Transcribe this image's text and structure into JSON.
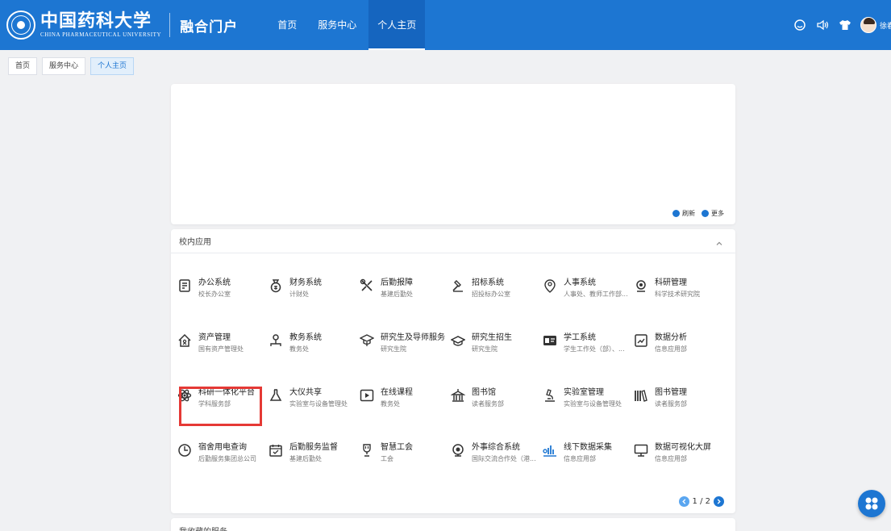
{
  "header": {
    "logo_cn": "中国药科大学",
    "logo_en": "CHINA PHARMACEUTICAL UNIVERSITY",
    "portal_title": "融合门户",
    "nav": [
      {
        "label": "首页",
        "active": false
      },
      {
        "label": "服务中心",
        "active": false
      },
      {
        "label": "个人主页",
        "active": true
      }
    ],
    "icons": [
      "chat-icon",
      "speaker-icon",
      "shirt-icon"
    ],
    "user_name": "徐春"
  },
  "tabs": [
    {
      "label": "首页",
      "active": false
    },
    {
      "label": "服务中心",
      "active": false
    },
    {
      "label": "个人主页",
      "active": true
    }
  ],
  "top_panel": {
    "refresh_label": "刷新",
    "more_label": "更多"
  },
  "apps_panel": {
    "title": "校内应用",
    "apps": [
      {
        "name": "办公系统",
        "sub": "校长办公室",
        "icon": "document-icon"
      },
      {
        "name": "财务系统",
        "sub": "计财处",
        "icon": "finance-icon"
      },
      {
        "name": "后勤报障",
        "sub": "基建后勤处",
        "icon": "tools-icon"
      },
      {
        "name": "招标系统",
        "sub": "招投标办公室",
        "icon": "gavel-icon"
      },
      {
        "name": "人事系统",
        "sub": "人事处、教师工作部...",
        "icon": "person-pin-icon"
      },
      {
        "name": "科研管理",
        "sub": "科学技术研究院",
        "icon": "research-icon"
      },
      {
        "name": "资产管理",
        "sub": "国有资产管理处",
        "icon": "house-icon"
      },
      {
        "name": "教务系统",
        "sub": "教务处",
        "icon": "org-icon"
      },
      {
        "name": "研究生及导师服务",
        "sub": "研究生院",
        "icon": "graduate-icon"
      },
      {
        "name": "研究生招生",
        "sub": "研究生院",
        "icon": "cap-icon"
      },
      {
        "name": "学工系统",
        "sub": "学生工作处（部）、...",
        "icon": "id-card-icon"
      },
      {
        "name": "数据分析",
        "sub": "信息应用部",
        "icon": "chart-icon"
      },
      {
        "name": "科研一体化平台",
        "sub": "学科服务部",
        "icon": "atom-icon"
      },
      {
        "name": "大仪共享",
        "sub": "实验室与设备管理处",
        "icon": "flask-icon"
      },
      {
        "name": "在线课程",
        "sub": "教务处",
        "icon": "play-icon"
      },
      {
        "name": "图书馆",
        "sub": "读者服务部",
        "icon": "library-icon"
      },
      {
        "name": "实验室管理",
        "sub": "实验室与设备管理处",
        "icon": "microscope-icon"
      },
      {
        "name": "图书管理",
        "sub": "读者服务部",
        "icon": "books-icon"
      },
      {
        "name": "宿舍用电查询",
        "sub": "后勤服务集团总公司",
        "icon": "clock-icon"
      },
      {
        "name": "后勤服务监督",
        "sub": "基建后勤处",
        "icon": "calendar-check-icon"
      },
      {
        "name": "智慧工会",
        "sub": "工会",
        "icon": "trophy-icon"
      },
      {
        "name": "外事综合系统",
        "sub": "国际交流合作处（港...",
        "icon": "globe-icon"
      },
      {
        "name": "线下数据采集",
        "sub": "信息应用部",
        "icon": "data-collect-icon"
      },
      {
        "name": "数据可视化大屏",
        "sub": "信息应用部",
        "icon": "monitor-icon"
      }
    ],
    "pager": "1 / 2"
  },
  "fav_panel": {
    "title": "我收藏的服务"
  },
  "colors": {
    "header_bg": "#1d76d2",
    "accent": "#1d76d2",
    "highlight": "#e53935"
  }
}
